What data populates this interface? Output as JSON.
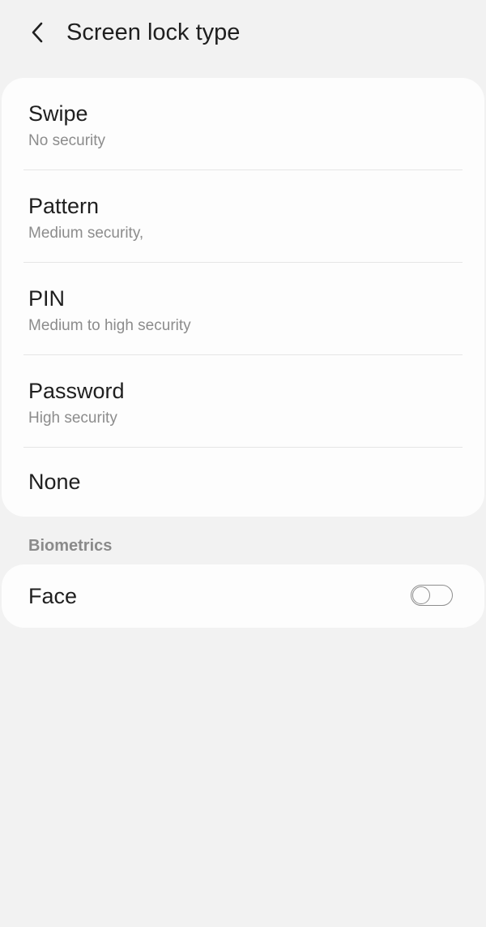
{
  "header": {
    "title": "Screen lock type",
    "back_icon": "chevron-left-icon"
  },
  "lock_types": [
    {
      "title": "Swipe",
      "subtitle": "No security"
    },
    {
      "title": "Pattern",
      "subtitle": "Medium security,"
    },
    {
      "title": "PIN",
      "subtitle": "Medium to high security"
    },
    {
      "title": "Password",
      "subtitle": "High security"
    },
    {
      "title": "None"
    }
  ],
  "biometrics": {
    "section_label": "Biometrics",
    "face": {
      "title": "Face",
      "toggle_state": "off"
    }
  },
  "colors": {
    "background": "#f2f2f2",
    "card": "#fdfdfd",
    "primary_text": "#1f1f1f",
    "secondary_text": "#8c8c8c",
    "toggle_outline": "#8e8e8e"
  }
}
